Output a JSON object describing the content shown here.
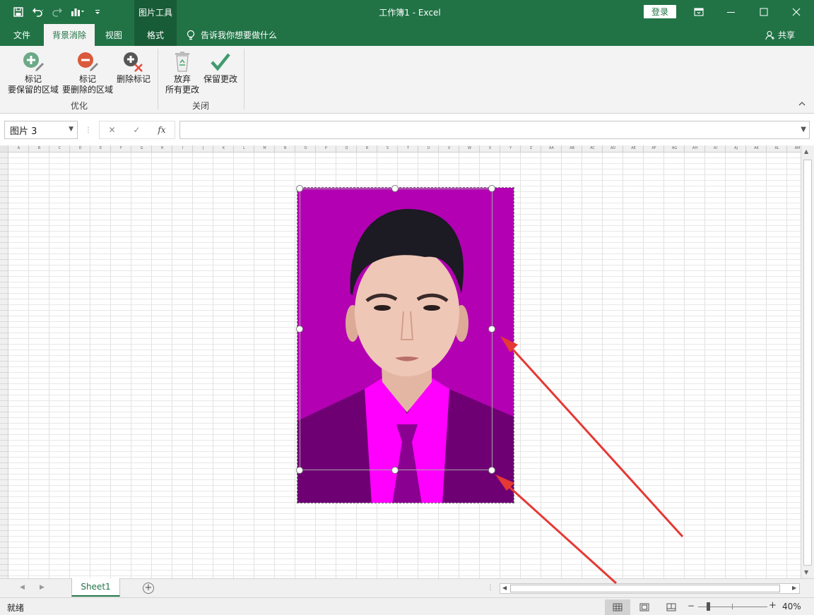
{
  "titlebar": {
    "context_tools": "图片工具",
    "window_title": "工作簿1  -  Excel",
    "login": "登录"
  },
  "tabs": [
    {
      "label": "文件"
    },
    {
      "label": "背景消除"
    },
    {
      "label": "视图"
    },
    {
      "label": "格式"
    }
  ],
  "tell_me": "告诉我你想要做什么",
  "share": "共享",
  "ribbon": {
    "mark_keep_l1": "标记",
    "mark_keep_l2": "要保留的区域",
    "mark_remove_l1": "标记",
    "mark_remove_l2": "要删除的区域",
    "delete_mark": "删除标记",
    "group_refine": "优化",
    "discard_l1": "放弃",
    "discard_l2": "所有更改",
    "keep_changes": "保留更改",
    "group_close": "关闭"
  },
  "formula_bar": {
    "name_box": "图片 3",
    "fx": "fx",
    "formula": ""
  },
  "grid": {
    "columns": [
      "A",
      "B",
      "C",
      "D",
      "E",
      "F",
      "G",
      "H",
      "I",
      "J",
      "K",
      "L",
      "M",
      "N",
      "O",
      "P",
      "Q",
      "R",
      "S",
      "T",
      "U",
      "V",
      "W",
      "X",
      "Y",
      "Z",
      "AA",
      "AB",
      "AC",
      "AD",
      "AE",
      "AF",
      "AG",
      "AH",
      "AI",
      "AJ",
      "AK",
      "AL",
      "AM"
    ]
  },
  "sheets": [
    {
      "label": "Sheet1"
    }
  ],
  "statusbar": {
    "ready": "就绪",
    "zoom": "40%",
    "zoom_level": 0.4
  },
  "colors": {
    "accent": "#217346",
    "accent_dark": "#185c37",
    "photo_bg": "#b300b3",
    "removed_magenta": "#ff00ff",
    "arrow": "#e53935"
  }
}
